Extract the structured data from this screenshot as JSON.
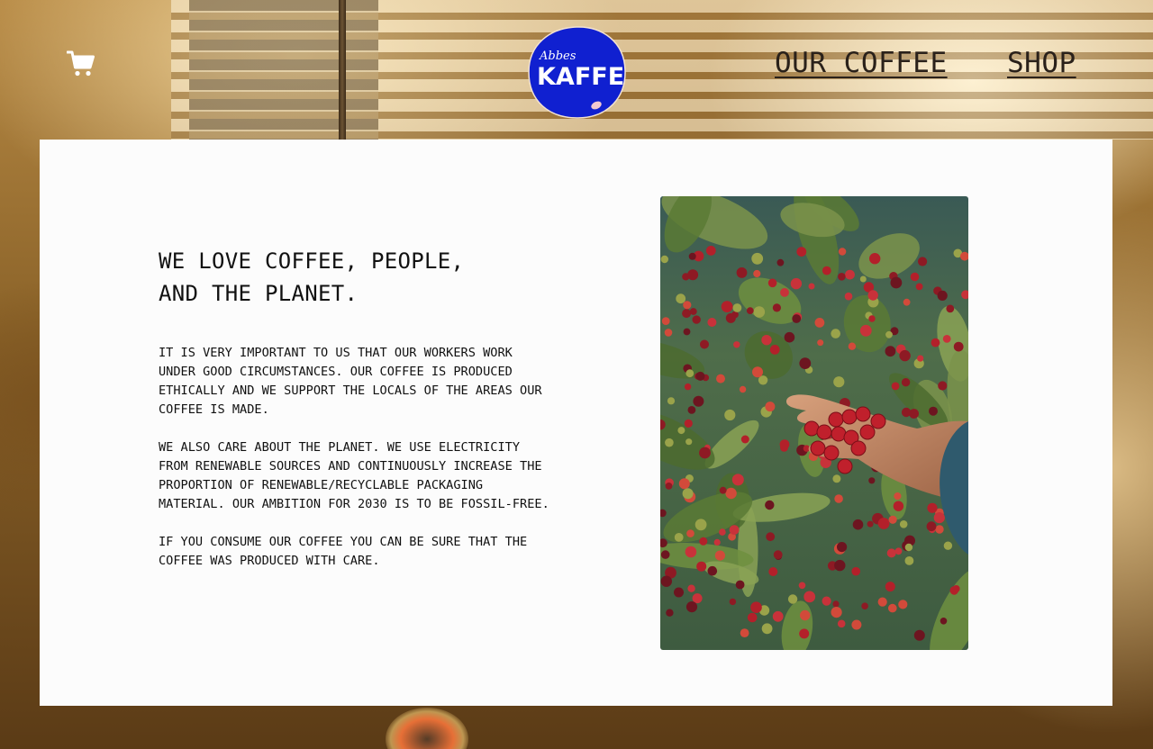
{
  "header": {
    "cart_icon": "shopping-cart-icon",
    "logo": {
      "script_text": "Abbes",
      "wordmark": "KAFFE",
      "color": "#1020d0"
    },
    "nav": [
      {
        "label": "OUR COFFEE"
      },
      {
        "label": "SHOP"
      }
    ]
  },
  "main": {
    "headline_line1": "WE LOVE COFFEE, PEOPLE,",
    "headline_line2": "AND THE PLANET.",
    "paragraphs": [
      "IT IS VERY IMPORTANT TO US THAT OUR WORKERS WORK UNDER GOOD CIRCUMSTANCES. OUR COFFEE IS PRODUCED ETHICALLY AND WE SUPPORT THE LOCALS OF THE AREAS OUR COFFEE IS MADE.",
      "WE ALSO CARE ABOUT THE PLANET. WE USE ELECTRICITY FROM RENEWABLE SOURCES AND CONTINUOUSLY INCREASE THE PROPORTION OF RENEWABLE/RECYCLABLE PACKAGING MATERIAL. OUR AMBITION FOR 2030 IS TO BE FOSSIL-FREE.",
      "IF YOU CONSUME OUR COFFEE YOU CAN BE SURE THAT THE COFFEE WAS PRODUCED WITH CARE."
    ],
    "photo_subject": "hand-holding-coffee-cherries-photo"
  },
  "colors": {
    "card_bg": "#fcfcfc",
    "text": "#111111",
    "nav_text": "#2a211a",
    "brand_blue": "#1020d0"
  }
}
